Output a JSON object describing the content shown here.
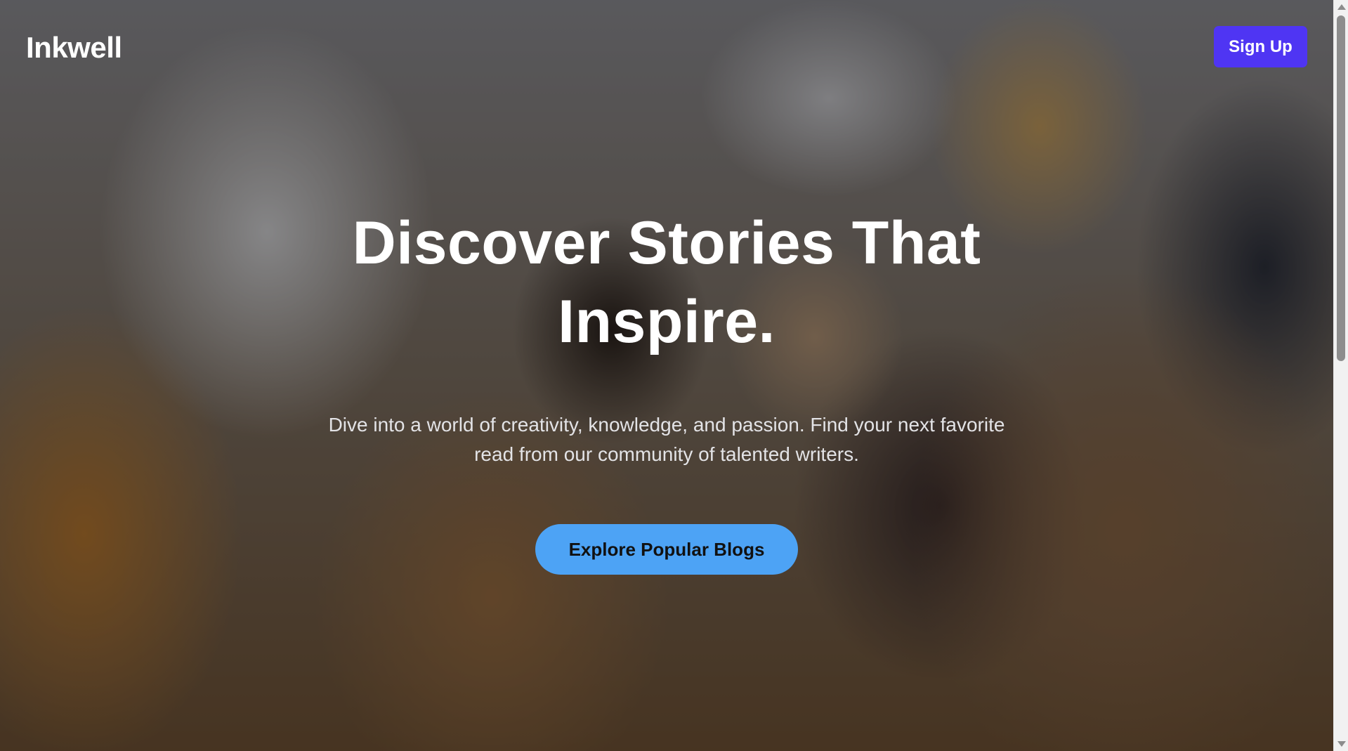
{
  "app": {
    "logo_text": "Inkwell"
  },
  "header": {
    "signup_label": "Sign Up"
  },
  "hero": {
    "title_line1": "Discover Stories That",
    "title_line2": "Inspire.",
    "subtitle_line1": "Dive into a world of creativity, knowledge, and passion. Find your next favorite",
    "subtitle_line2": "read from our community of talented writers.",
    "cta_label": "Explore Popular Blogs"
  },
  "scrollbar": {
    "position_fraction": 0.0
  },
  "colors": {
    "signup_bg": "#4f35f3",
    "cta_bg": "#4da3f5",
    "overlay": "rgba(0,0,0,0.42)"
  }
}
